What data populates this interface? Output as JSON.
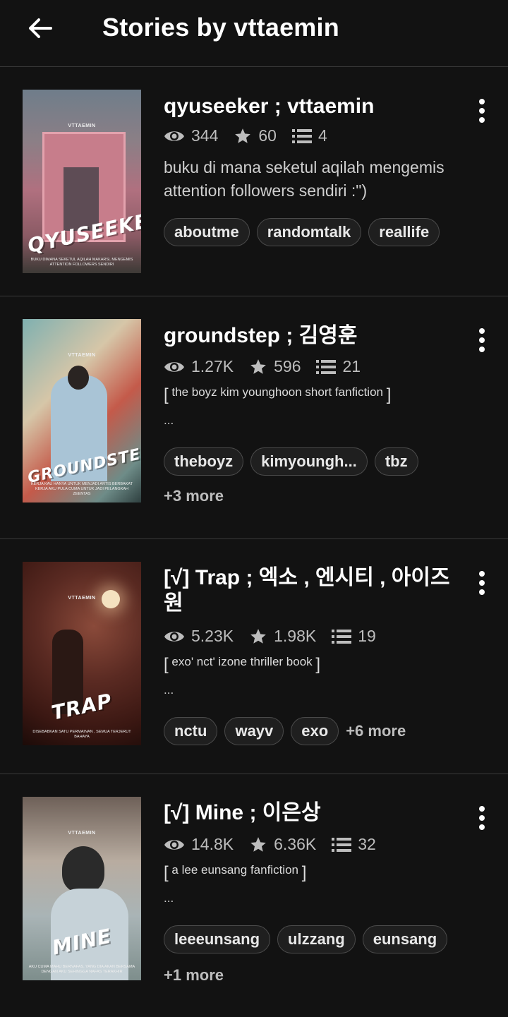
{
  "header": {
    "title": "Stories by vttaemin"
  },
  "stories": [
    {
      "title": "qyuseeker ; vttaemin",
      "reads": "344",
      "votes": "60",
      "parts": "4",
      "description": "buku di mana seketul aqilah mengemis attention followers sendiri :\")",
      "tags": [
        "aboutme",
        "randomtalk",
        "reallife"
      ],
      "cover": {
        "mark": "VTTAEMIN",
        "title": "QYUSEEKER",
        "caption": "BUKU DIMANA SEKETUL AQILAH MAKARSL MENGEMIS ATTENTION FOLLOWERS SENDIRI"
      }
    },
    {
      "title": "groundstep ; 김영훈",
      "reads": "1.27K",
      "votes": "596",
      "parts": "21",
      "description": "the boyz kim younghoon short fanfiction",
      "ellipsis": "...",
      "tags": [
        "theboyz",
        "kimyoungh...",
        "tbz"
      ],
      "more": "+3 more",
      "cover": {
        "mark": "VTTAEMIN",
        "title": "GROUNDSTEP",
        "caption": "KERJA KAU HANYA UNTUK MENJADI ARTIS BERBAKAT KERJA AKU PULA CUMA UNTUK JADI PELANGKAH ZEENTAS"
      }
    },
    {
      "title": "[√] Trap ; 엑소 , 엔시티 , 아이즈원",
      "reads": "5.23K",
      "votes": "1.98K",
      "parts": "19",
      "description": "exo' nct'  izone thriller book",
      "ellipsis": "...",
      "tags": [
        "nctu",
        "wayv",
        "exo"
      ],
      "more": "+6 more",
      "cover": {
        "mark": "VTTAEMIN",
        "title": "TRAP",
        "caption": "DISEBABKAN SATU PERMAINAN , SEMUA TERJERUT BAHAYA"
      }
    },
    {
      "title": "[√] Mine ; 이은상",
      "reads": "14.8K",
      "votes": "6.36K",
      "parts": "32",
      "description": "a lee eunsang fanfiction",
      "ellipsis": "...",
      "tags": [
        "leeeunsang",
        "ulzzang",
        "eunsang"
      ],
      "more": "+1 more",
      "cover": {
        "mark": "VTTAEMIN",
        "title": "MINE",
        "caption": "AKU CUMA MAHU BERNAFAS, YANG DIA AKAN BERSAMA DENGAN AKU SEHINGGA NAFAS TERAKHIR"
      }
    }
  ]
}
